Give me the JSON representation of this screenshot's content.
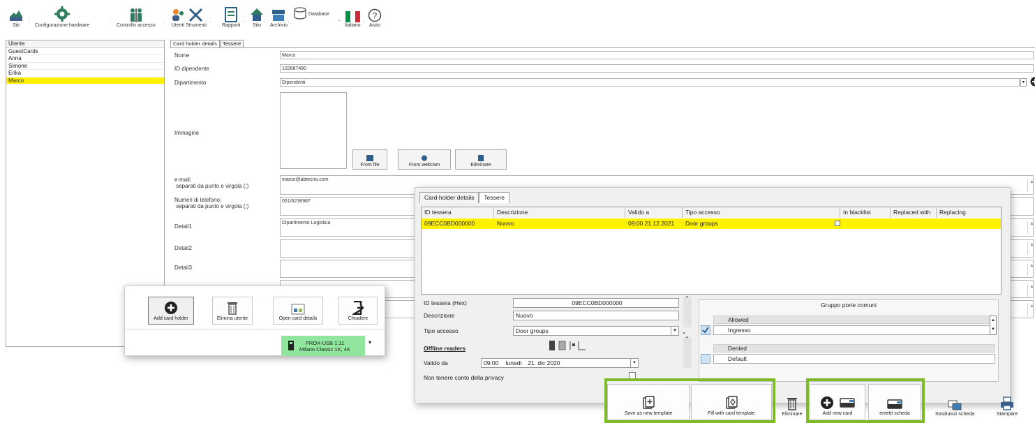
{
  "toolbar": {
    "items": [
      {
        "label": "Siti",
        "icon": "sites-icon"
      },
      {
        "label": "Configurazione hardware",
        "icon": "gear-icon"
      },
      {
        "label": "Controllo accesso",
        "icon": "access-control-icon"
      },
      {
        "label": "Utenti",
        "icon": "users-icon"
      },
      {
        "label": "Strumenti",
        "icon": "tools-icon"
      },
      {
        "label": "Rapporti",
        "icon": "reports-icon"
      },
      {
        "label": "Sito",
        "icon": "home-icon"
      },
      {
        "label": "Archivio",
        "icon": "archive-icon"
      },
      {
        "label": "Database",
        "icon": "database-icon"
      },
      {
        "label": "Italiano",
        "icon": "italy-flag-icon"
      },
      {
        "label": "Aiuto",
        "icon": "help-icon"
      }
    ]
  },
  "userlist": {
    "header": "Utente",
    "items": [
      "GuestCards",
      "Anna",
      "Simone",
      "Erika",
      "Marco"
    ],
    "selected": "Marco"
  },
  "back_tabs": [
    "Card holder details",
    "Tessere"
  ],
  "details": {
    "name_label": "Nome",
    "name_value": "Marco",
    "employee_id_label": "ID dipendente",
    "employee_id_value": "102687480",
    "department_label": "Dipartimento",
    "department_value": "Dipendenti",
    "image_label": "Immagine",
    "btn_from_file": "From file",
    "btn_from_webcam": "From webcam",
    "btn_delete": "Eliminare",
    "email_label_1": "e-mail;",
    "email_label_2": "separati da punto e virgola (;)",
    "email_value": "marco@abtecno.com",
    "phone_label_1": "Numeri di telefono;",
    "phone_label_2": "separati da punto e virgola (;)",
    "phone_value": "051/6236987",
    "detail1_label": "Detail1",
    "detail1_value": "Dipartimento Logistica",
    "detail2_label": "Detail2",
    "detail3_label": "Detail3"
  },
  "popup": {
    "add": "Add card holder",
    "delete_user": "Elimina utente",
    "open_details": "Open card details",
    "close": "Chiudere",
    "status_line1": "PROX-USB 1.11",
    "status_line2": "Milano Classic 1K, 4K"
  },
  "front": {
    "tabs": [
      "Card holder details",
      "Tessere"
    ],
    "columns": [
      "ID tessera",
      "Descrizione",
      "Valido a",
      "Tipo accesso",
      "In blacklist",
      "Replaced with",
      "Replacing"
    ],
    "row": {
      "id": "09ECC0BD000000",
      "desc": "Nuovo",
      "valid_to": "09:00 21.12.2021",
      "access": "Door groups"
    },
    "id_hex_label": "ID tessera (Hex)",
    "id_hex_value": "09ECC0BD000000",
    "desc_label": "Descrizione",
    "desc_value": "Nuovo",
    "access_label": "Tipo accesso",
    "access_value": "Door groups",
    "offline_label": "Offline readers",
    "valid_from_label": "Valido da",
    "valid_from_time": "09:00",
    "valid_from_day": "lunedì",
    "valid_from_date": "21. dic 2020",
    "privacy_label": "Non tenere conto della privacy",
    "group_title": "Gruppo porte comuni",
    "allowed": "Allowed",
    "ingresso": "Ingresso",
    "denied": "Denied",
    "default": "Default"
  },
  "bottom_toolbar": {
    "save_template": "Save as new template",
    "fill_template": "Fill with card template",
    "delete": "Eliminare",
    "add_card": "Add new card",
    "issue_card": "emetti scheda",
    "replace_card": "Sostituisci scheda",
    "print": "Stampare"
  },
  "colors": {
    "selected_row": "#fff200",
    "highlight_green": "#7dbb27",
    "status_green": "#8fe69c"
  }
}
